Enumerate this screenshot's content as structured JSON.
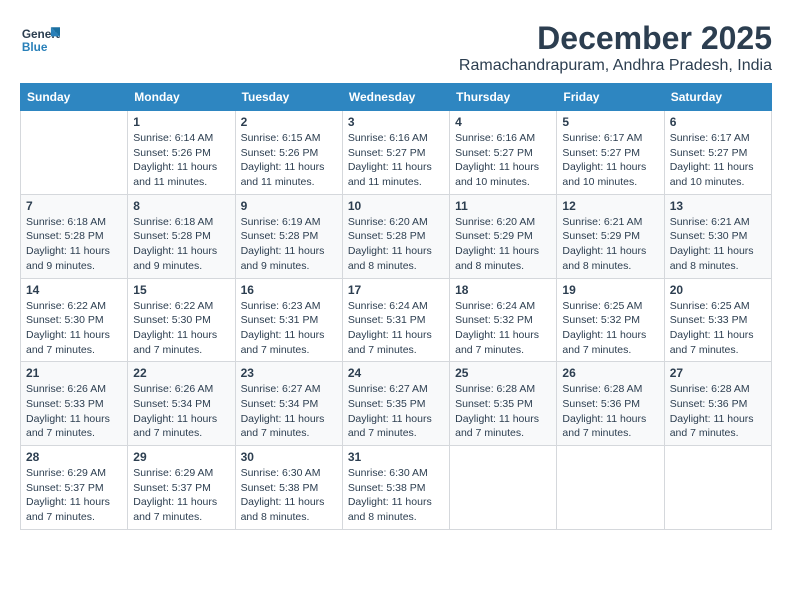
{
  "logo": {
    "text_general": "General",
    "text_blue": "Blue"
  },
  "title": {
    "month": "December 2025",
    "location": "Ramachandrapuram, Andhra Pradesh, India"
  },
  "weekdays": [
    "Sunday",
    "Monday",
    "Tuesday",
    "Wednesday",
    "Thursday",
    "Friday",
    "Saturday"
  ],
  "weeks": [
    [
      {
        "day": "",
        "sunrise": "",
        "sunset": "",
        "daylight": ""
      },
      {
        "day": "1",
        "sunrise": "Sunrise: 6:14 AM",
        "sunset": "Sunset: 5:26 PM",
        "daylight": "Daylight: 11 hours and 11 minutes."
      },
      {
        "day": "2",
        "sunrise": "Sunrise: 6:15 AM",
        "sunset": "Sunset: 5:26 PM",
        "daylight": "Daylight: 11 hours and 11 minutes."
      },
      {
        "day": "3",
        "sunrise": "Sunrise: 6:16 AM",
        "sunset": "Sunset: 5:27 PM",
        "daylight": "Daylight: 11 hours and 11 minutes."
      },
      {
        "day": "4",
        "sunrise": "Sunrise: 6:16 AM",
        "sunset": "Sunset: 5:27 PM",
        "daylight": "Daylight: 11 hours and 10 minutes."
      },
      {
        "day": "5",
        "sunrise": "Sunrise: 6:17 AM",
        "sunset": "Sunset: 5:27 PM",
        "daylight": "Daylight: 11 hours and 10 minutes."
      },
      {
        "day": "6",
        "sunrise": "Sunrise: 6:17 AM",
        "sunset": "Sunset: 5:27 PM",
        "daylight": "Daylight: 11 hours and 10 minutes."
      }
    ],
    [
      {
        "day": "7",
        "sunrise": "Sunrise: 6:18 AM",
        "sunset": "Sunset: 5:28 PM",
        "daylight": "Daylight: 11 hours and 9 minutes."
      },
      {
        "day": "8",
        "sunrise": "Sunrise: 6:18 AM",
        "sunset": "Sunset: 5:28 PM",
        "daylight": "Daylight: 11 hours and 9 minutes."
      },
      {
        "day": "9",
        "sunrise": "Sunrise: 6:19 AM",
        "sunset": "Sunset: 5:28 PM",
        "daylight": "Daylight: 11 hours and 9 minutes."
      },
      {
        "day": "10",
        "sunrise": "Sunrise: 6:20 AM",
        "sunset": "Sunset: 5:28 PM",
        "daylight": "Daylight: 11 hours and 8 minutes."
      },
      {
        "day": "11",
        "sunrise": "Sunrise: 6:20 AM",
        "sunset": "Sunset: 5:29 PM",
        "daylight": "Daylight: 11 hours and 8 minutes."
      },
      {
        "day": "12",
        "sunrise": "Sunrise: 6:21 AM",
        "sunset": "Sunset: 5:29 PM",
        "daylight": "Daylight: 11 hours and 8 minutes."
      },
      {
        "day": "13",
        "sunrise": "Sunrise: 6:21 AM",
        "sunset": "Sunset: 5:30 PM",
        "daylight": "Daylight: 11 hours and 8 minutes."
      }
    ],
    [
      {
        "day": "14",
        "sunrise": "Sunrise: 6:22 AM",
        "sunset": "Sunset: 5:30 PM",
        "daylight": "Daylight: 11 hours and 7 minutes."
      },
      {
        "day": "15",
        "sunrise": "Sunrise: 6:22 AM",
        "sunset": "Sunset: 5:30 PM",
        "daylight": "Daylight: 11 hours and 7 minutes."
      },
      {
        "day": "16",
        "sunrise": "Sunrise: 6:23 AM",
        "sunset": "Sunset: 5:31 PM",
        "daylight": "Daylight: 11 hours and 7 minutes."
      },
      {
        "day": "17",
        "sunrise": "Sunrise: 6:24 AM",
        "sunset": "Sunset: 5:31 PM",
        "daylight": "Daylight: 11 hours and 7 minutes."
      },
      {
        "day": "18",
        "sunrise": "Sunrise: 6:24 AM",
        "sunset": "Sunset: 5:32 PM",
        "daylight": "Daylight: 11 hours and 7 minutes."
      },
      {
        "day": "19",
        "sunrise": "Sunrise: 6:25 AM",
        "sunset": "Sunset: 5:32 PM",
        "daylight": "Daylight: 11 hours and 7 minutes."
      },
      {
        "day": "20",
        "sunrise": "Sunrise: 6:25 AM",
        "sunset": "Sunset: 5:33 PM",
        "daylight": "Daylight: 11 hours and 7 minutes."
      }
    ],
    [
      {
        "day": "21",
        "sunrise": "Sunrise: 6:26 AM",
        "sunset": "Sunset: 5:33 PM",
        "daylight": "Daylight: 11 hours and 7 minutes."
      },
      {
        "day": "22",
        "sunrise": "Sunrise: 6:26 AM",
        "sunset": "Sunset: 5:34 PM",
        "daylight": "Daylight: 11 hours and 7 minutes."
      },
      {
        "day": "23",
        "sunrise": "Sunrise: 6:27 AM",
        "sunset": "Sunset: 5:34 PM",
        "daylight": "Daylight: 11 hours and 7 minutes."
      },
      {
        "day": "24",
        "sunrise": "Sunrise: 6:27 AM",
        "sunset": "Sunset: 5:35 PM",
        "daylight": "Daylight: 11 hours and 7 minutes."
      },
      {
        "day": "25",
        "sunrise": "Sunrise: 6:28 AM",
        "sunset": "Sunset: 5:35 PM",
        "daylight": "Daylight: 11 hours and 7 minutes."
      },
      {
        "day": "26",
        "sunrise": "Sunrise: 6:28 AM",
        "sunset": "Sunset: 5:36 PM",
        "daylight": "Daylight: 11 hours and 7 minutes."
      },
      {
        "day": "27",
        "sunrise": "Sunrise: 6:28 AM",
        "sunset": "Sunset: 5:36 PM",
        "daylight": "Daylight: 11 hours and 7 minutes."
      }
    ],
    [
      {
        "day": "28",
        "sunrise": "Sunrise: 6:29 AM",
        "sunset": "Sunset: 5:37 PM",
        "daylight": "Daylight: 11 hours and 7 minutes."
      },
      {
        "day": "29",
        "sunrise": "Sunrise: 6:29 AM",
        "sunset": "Sunset: 5:37 PM",
        "daylight": "Daylight: 11 hours and 7 minutes."
      },
      {
        "day": "30",
        "sunrise": "Sunrise: 6:30 AM",
        "sunset": "Sunset: 5:38 PM",
        "daylight": "Daylight: 11 hours and 8 minutes."
      },
      {
        "day": "31",
        "sunrise": "Sunrise: 6:30 AM",
        "sunset": "Sunset: 5:38 PM",
        "daylight": "Daylight: 11 hours and 8 minutes."
      },
      {
        "day": "",
        "sunrise": "",
        "sunset": "",
        "daylight": ""
      },
      {
        "day": "",
        "sunrise": "",
        "sunset": "",
        "daylight": ""
      },
      {
        "day": "",
        "sunrise": "",
        "sunset": "",
        "daylight": ""
      }
    ]
  ]
}
